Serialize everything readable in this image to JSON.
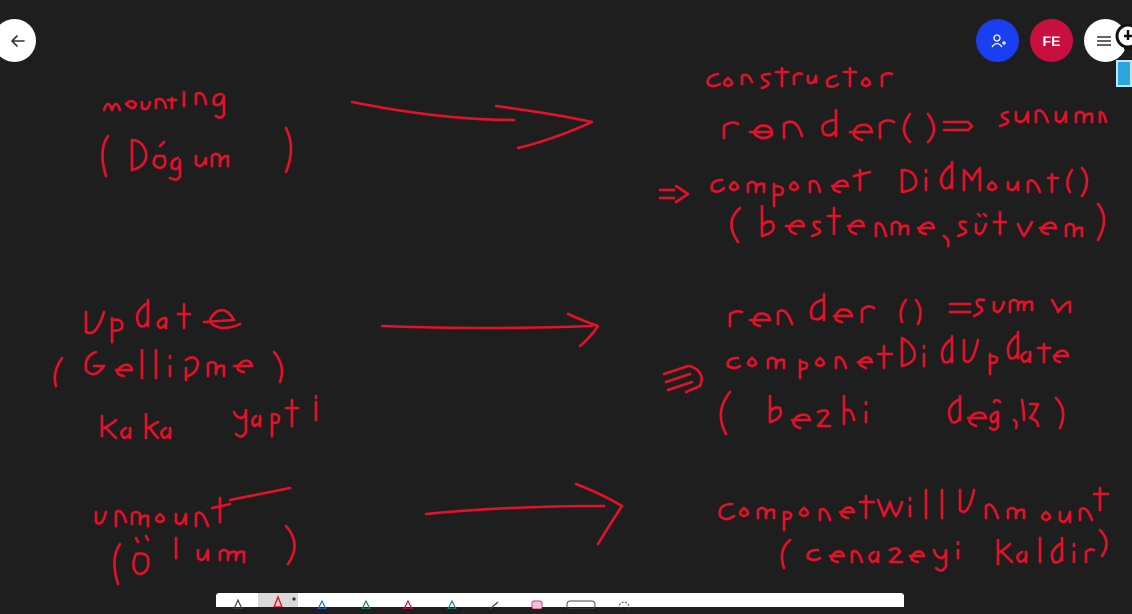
{
  "header": {
    "avatar_initials": "FE"
  },
  "icons": {
    "back": "arrow-left-icon",
    "invite": "add-person-icon",
    "menu": "hamburger-menu-icon",
    "extension": "lightbulb-icon"
  },
  "colors": {
    "canvas_background": "#1f1e1f",
    "ink": "#e5102a",
    "invite_button": "#1a3ff0",
    "avatar": "#c8103f",
    "toolbar": "#ffffff"
  },
  "toolbar": {
    "tools": [
      "select-tool",
      "pen-tool",
      "pen-blue-tool",
      "pen-green-tool",
      "pen-red-tool",
      "pen-teal-tool",
      "ruler-tool",
      "highlighter-tool",
      "eraser-tool",
      "lasso-tool"
    ],
    "selected_tool": "pen-tool"
  }
}
